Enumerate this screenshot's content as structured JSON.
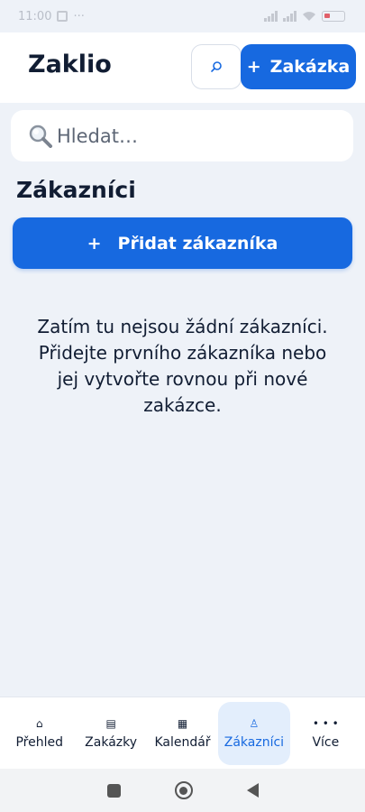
{
  "status_bar": {
    "time": "11:00",
    "dots": "···"
  },
  "header": {
    "title": "Zaklio",
    "search_icon": "search-icon",
    "new_order_plus": "+",
    "new_order_label": "Zakázka"
  },
  "search": {
    "placeholder": "Hledat…",
    "value": ""
  },
  "main": {
    "section_title": "Zákazníci",
    "add_plus": "+",
    "add_label": "Přidat zákazníka",
    "empty_message": "Zatím tu nejsou žádní zákazníci. Přidejte prvního zákazníka nebo jej vytvořte rovnou při nové zakázce."
  },
  "bottom_nav": {
    "items": [
      {
        "label": "Přehled",
        "icon": "⌂"
      },
      {
        "label": "Zakázky",
        "icon": "▤"
      },
      {
        "label": "Kalendář",
        "icon": "▦"
      },
      {
        "label": "Zákazníci",
        "icon": "♙",
        "active": true
      },
      {
        "label": "Více",
        "icon": "• • •"
      }
    ]
  },
  "colors": {
    "accent": "#1769e0",
    "background": "#eef2f8",
    "text": "#111d33"
  }
}
